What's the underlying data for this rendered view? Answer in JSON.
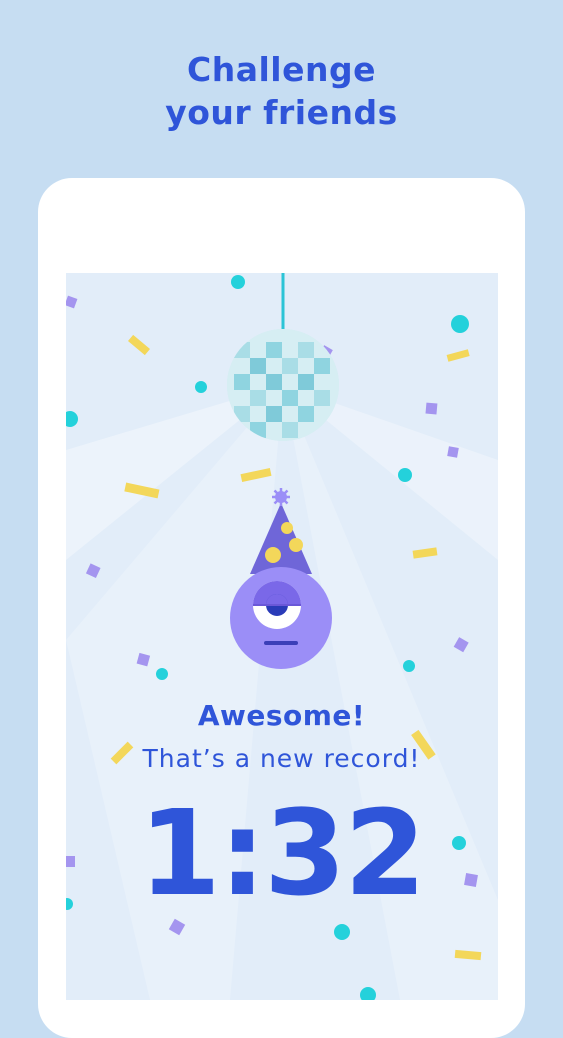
{
  "header": {
    "line1": "Challenge",
    "line2": "your friends"
  },
  "result": {
    "title": "Awesome!",
    "subtitle": "That’s a new record!",
    "time": "1:32"
  },
  "colors": {
    "background": "#c6ddf2",
    "accent_blue": "#2f55d9",
    "mascot_purple": "#9b8ef7",
    "confetti_yellow": "#f3d75a",
    "confetti_cyan": "#24d1db",
    "confetti_purple": "#a495ef"
  },
  "icons": {
    "disco_ball": "disco-ball-icon",
    "mascot": "party-mascot-icon",
    "party_hat": "party-hat-icon"
  }
}
